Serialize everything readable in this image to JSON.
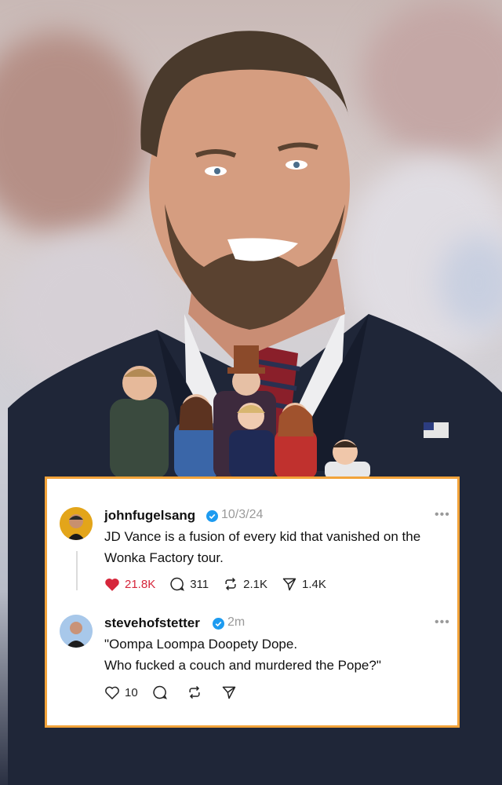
{
  "posts": [
    {
      "username": "johnfugelsang",
      "time": "10/3/24",
      "text_line1": "JD Vance is a fusion of every kid that vanished on the",
      "text_line2": "Wonka Factory tour.",
      "likes": "21.8K",
      "replies": "311",
      "reposts": "2.1K",
      "shares": "1.4K",
      "liked": true
    },
    {
      "username": "stevehofstetter",
      "time": "2m",
      "text_line1": "\"Oompa Loompa Doopety Dope.",
      "text_line2": "Who fucked a couch and murdered the Pope?\"",
      "likes": "10"
    }
  ],
  "more_label": "•••",
  "colors": {
    "card_border": "#f2a33a",
    "like_red": "#d6263b",
    "verified_blue": "#1d9bf0"
  }
}
